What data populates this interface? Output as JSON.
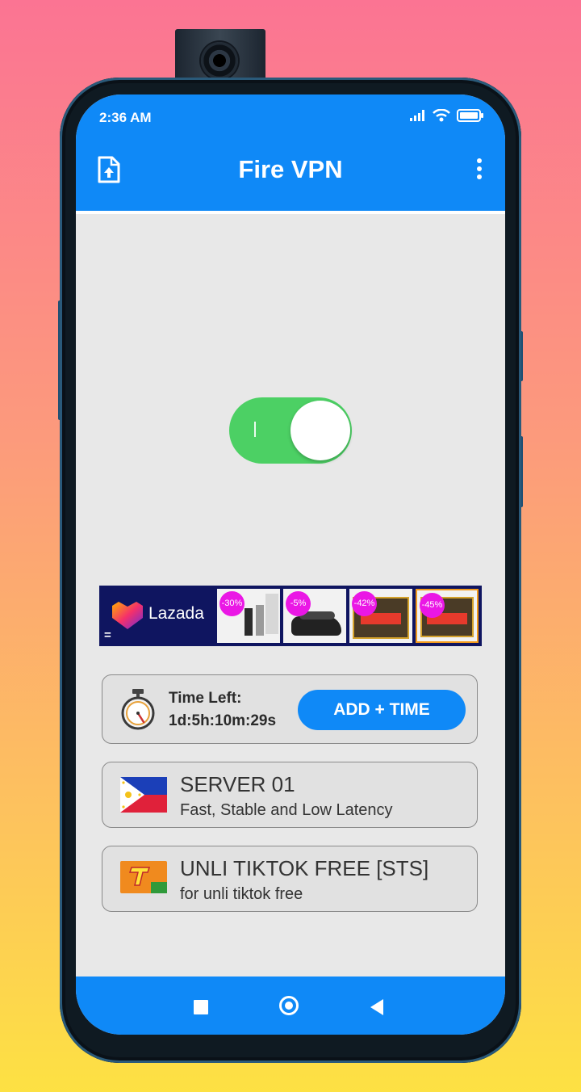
{
  "status_bar": {
    "time": "2:36 AM"
  },
  "app_bar": {
    "title": "Fire VPN"
  },
  "vpn_toggle": {
    "state": "on",
    "mark": "I"
  },
  "ad_banner": {
    "brand": "Lazada",
    "equals": "=",
    "tiles": [
      {
        "discount": "-30%"
      },
      {
        "discount": "-5%"
      },
      {
        "discount": "-42%"
      },
      {
        "discount": "-45%"
      }
    ]
  },
  "timer_card": {
    "label": "Time Left:",
    "value": "1d:5h:10m:29s",
    "button_label": "ADD + TIME"
  },
  "servers": [
    {
      "name": "SERVER 01",
      "description": "Fast, Stable and Low Latency",
      "flag_icon": "philippines-flag-icon"
    },
    {
      "name": "UNLI TIKTOK FREE [STS]",
      "description": "for unli tiktok free",
      "flag_icon": "tnt-logo-icon"
    }
  ],
  "colors": {
    "primary": "#0f89f7",
    "toggle_on": "#4cd064",
    "ad_background": "#0f1560",
    "discount_badge": "#ea17e5"
  }
}
